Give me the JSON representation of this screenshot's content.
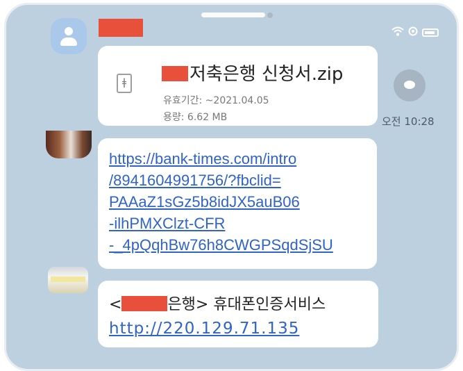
{
  "sender": {
    "name_redacted": true
  },
  "file_message": {
    "file_name": "저축은행 신청서.zip",
    "validity": "유효기간: ~2021.04.05",
    "size": "용량: 6.62 MB"
  },
  "timestamp": "오전 10:28",
  "link_message": {
    "lines": [
      "https://bank-times.com/intro",
      "/8941604991756/?fbclid=",
      "PAAaZ1sGz5b8idJX5auB06",
      "-ilhPMXClzt-CFR",
      "-_4pQqhBw76h8CWGPSqdSjSU"
    ]
  },
  "sms_message": {
    "prefix": "<",
    "suffix": "은행> 휴대폰인증서비스",
    "link": "http://220.129.71.135"
  },
  "icons": [
    "avatar-icon",
    "wifi-icon",
    "alarm-icon",
    "battery-icon",
    "zip-file-icon",
    "share-icon"
  ],
  "colors": {
    "background": "#bdd0e0",
    "bubble": "#ffffff",
    "link": "#2f63c8",
    "redaction": "#e8503c"
  }
}
